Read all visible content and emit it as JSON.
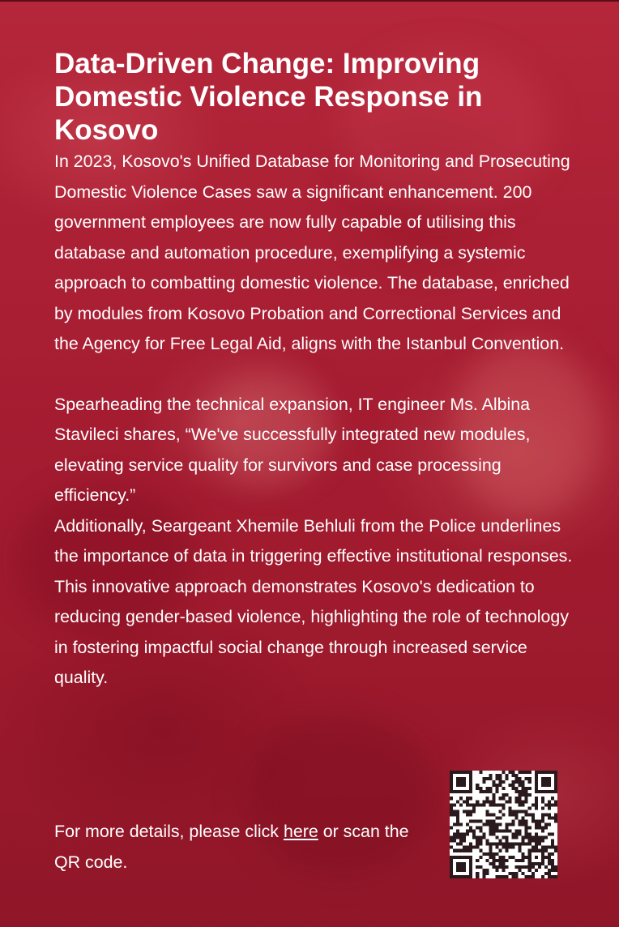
{
  "article": {
    "title": "Data-Driven Change: Improving Domestic Violence Response in Kosovo",
    "paragraph_1": "In 2023, Kosovo's Unified Database for Monitoring and Prosecuting Domestic Violence Cases saw a significant enhancement. 200 government employees are now fully capable of utilising this database and automation procedure, exemplifying a systemic approach to combatting domestic violence. The database, enriched by modules from Kosovo Probation and Correctional Services and the Agency for Free Legal Aid, aligns with the Istanbul Convention.",
    "paragraph_2": "Spearheading the technical expansion, IT engineer Ms. Albina Stavileci shares, “We've successfully integrated new modules, elevating service quality for survivors and case processing efficiency.”",
    "paragraph_3": "Additionally, Seargeant Xhemile Behluli from the Police underlines the importance of data in triggering effective institutional responses. This innovative approach demonstrates Kosovo's dedication to reducing gender-based violence, highlighting the role of technology in fostering impactful social change through increased service quality."
  },
  "footer": {
    "text_before_link": "For more details, please click ",
    "link_label": "here",
    "text_after_link": " or scan the QR code."
  },
  "qr_code": {
    "icon": "qr-code-icon"
  },
  "colors": {
    "background": "#a51c31",
    "text": "#ffffff"
  }
}
